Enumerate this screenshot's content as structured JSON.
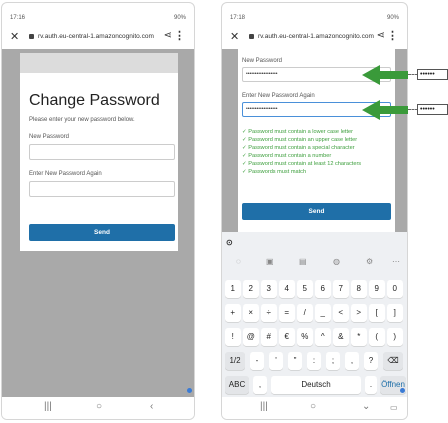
{
  "left": {
    "status_time": "17:16",
    "status_right": "90%",
    "url": "rv.auth.eu-central-1.amazoncognito.com",
    "heading": "Change Password",
    "subtitle": "Please enter your new password below.",
    "new_password_label": "New Password",
    "new_password_value": "",
    "again_label": "Enter New Password Again",
    "again_value": "",
    "send_label": "Send"
  },
  "right": {
    "status_time": "17:18",
    "status_right": "90%",
    "url": "rv.auth.eu-central-1.amazoncognito.com",
    "new_password_label": "New Password",
    "new_password_value": "••••••••••••••••••",
    "again_label": "Enter New Password Again",
    "again_value": "••••••••••••••••••",
    "rules": [
      "✓ Password must contain a lower case letter",
      "✓ Password must contain an upper case letter",
      "✓ Password must contain a special character",
      "✓ Password must contain a number",
      "✓ Password must contain at least 12 characters",
      "✓ Passwords must match"
    ],
    "send_label": "Send"
  },
  "keyboard": {
    "row1": [
      "1",
      "2",
      "3",
      "4",
      "5",
      "6",
      "7",
      "8",
      "9",
      "0"
    ],
    "row2": [
      "+",
      "×",
      "÷",
      "=",
      "/",
      "_",
      "<",
      ">",
      "[",
      "]"
    ],
    "row3": [
      "!",
      "@",
      "#",
      "€",
      "%",
      "^",
      "&",
      "*",
      "(",
      ")"
    ],
    "row4": [
      "1/2",
      "-",
      "'",
      "\"",
      ":",
      ";",
      ",",
      "?",
      "⌫"
    ],
    "row5": {
      "abc": "ABC",
      "comma": ",",
      "space": "Deutsch",
      "period": ".",
      "enter": "Öffnen"
    }
  },
  "annotation": {
    "box1": "••••••",
    "box2": "••••••"
  },
  "colors": {
    "accent": "#1f6fa8",
    "rule_green": "#3c9e3c",
    "arrow_green": "#3a9a3a",
    "backdrop": "#a9a9a9"
  }
}
